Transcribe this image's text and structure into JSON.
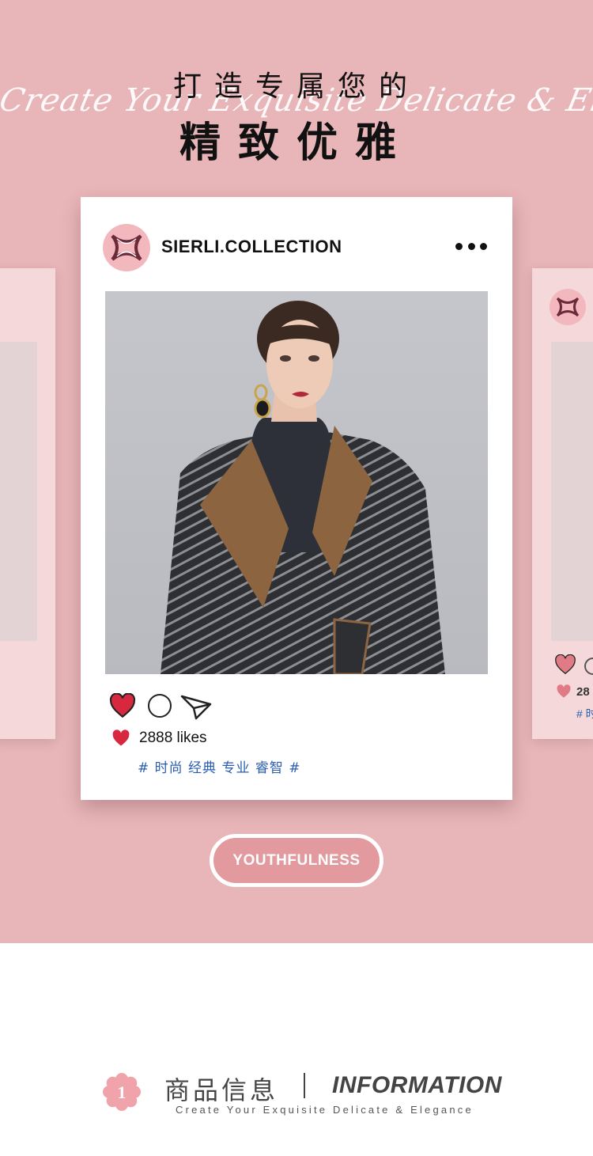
{
  "hero": {
    "title_line1": "打造专属您的",
    "script_text": "Create Your Exquisite Delicate & Elegance",
    "title_line2": "精致优雅"
  },
  "post": {
    "account_name": "SIERLI.COLLECTION",
    "more_icon": "more-dots-icon",
    "likes_text": "2888 likes",
    "hashtags": "# 时尚 经典 专业 睿智 #",
    "icons": [
      "heart-icon",
      "comment-icon",
      "share-icon"
    ]
  },
  "side_cards": {
    "right_likes": "28",
    "right_tags": "# 时"
  },
  "button": {
    "label": "YOUTHFULNESS"
  },
  "info": {
    "number": "1",
    "title_cn": "商品信息",
    "title_en": "INFORMATION",
    "subtitle": "Create Your Exquisite Delicate & Elegance"
  },
  "colors": {
    "background_pink": "#e8b5b8",
    "logo_pink": "#f2b8bd",
    "heart_red": "#d8283f",
    "hashtag_blue": "#2a5db0",
    "button_fill": "#e29a9f"
  }
}
